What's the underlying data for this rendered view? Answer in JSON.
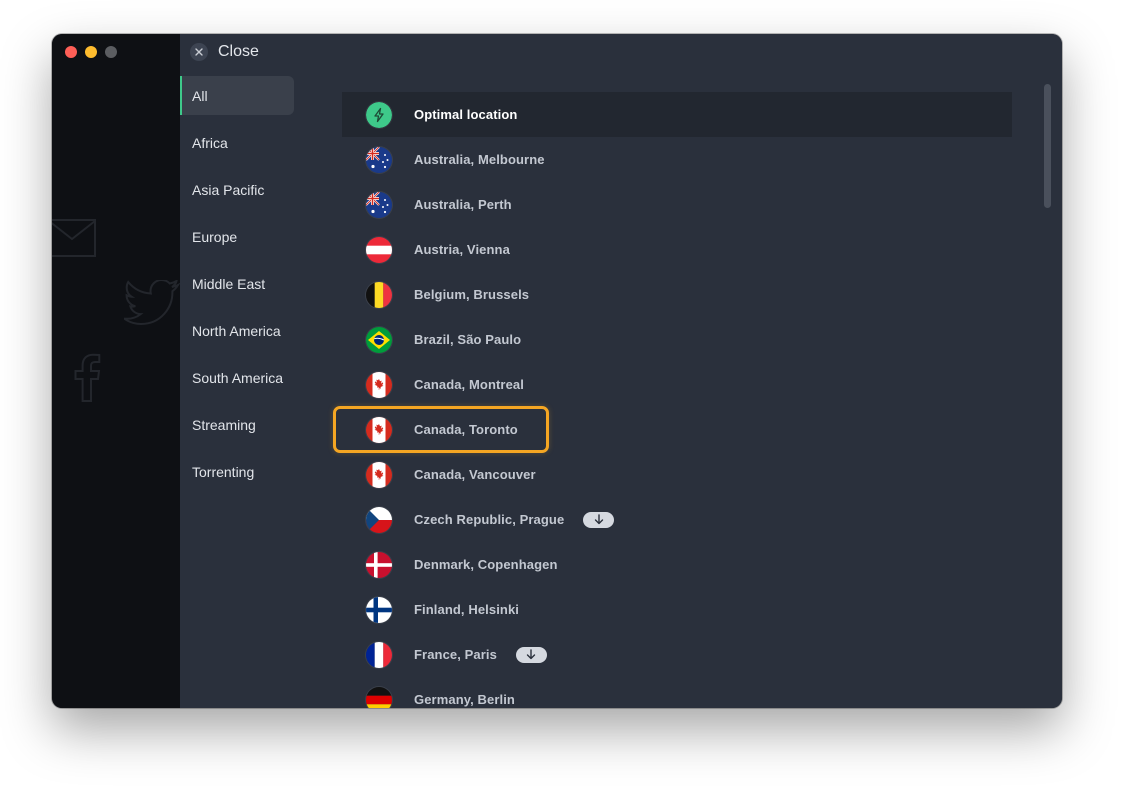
{
  "window": {
    "close_label": "Close"
  },
  "categories": [
    {
      "label": "All",
      "active": true
    },
    {
      "label": "Africa"
    },
    {
      "label": "Asia Pacific"
    },
    {
      "label": "Europe"
    },
    {
      "label": "Middle East"
    },
    {
      "label": "North America"
    },
    {
      "label": "South America"
    },
    {
      "label": "Streaming"
    },
    {
      "label": "Torrenting"
    }
  ],
  "locations": [
    {
      "label": "Optimal location",
      "icon": "bolt-icon"
    },
    {
      "label": "Australia, Melbourne",
      "flag": "australia-flag-icon"
    },
    {
      "label": "Australia, Perth",
      "flag": "australia-flag-icon"
    },
    {
      "label": "Austria, Vienna",
      "flag": "austria-flag-icon"
    },
    {
      "label": "Belgium, Brussels",
      "flag": "belgium-flag-icon"
    },
    {
      "label": "Brazil, São Paulo",
      "flag": "brazil-flag-icon"
    },
    {
      "label": "Canada, Montreal",
      "flag": "canada-flag-icon"
    },
    {
      "label": "Canada, Toronto",
      "flag": "canada-flag-icon",
      "highlighted": true
    },
    {
      "label": "Canada, Vancouver",
      "flag": "canada-flag-icon"
    },
    {
      "label": "Czech Republic, Prague",
      "flag": "czech-flag-icon",
      "badge": "download-arrow-icon"
    },
    {
      "label": "Denmark, Copenhagen",
      "flag": "denmark-flag-icon"
    },
    {
      "label": "Finland, Helsinki",
      "flag": "finland-flag-icon"
    },
    {
      "label": "France, Paris",
      "flag": "france-flag-icon",
      "badge": "download-arrow-icon"
    },
    {
      "label": "Germany, Berlin",
      "flag": "germany-flag-icon"
    }
  ],
  "colors": {
    "accent_green": "#3ec98a",
    "highlight_orange": "#f5a623",
    "panel_bg": "#2a303c",
    "sidebar_bg": "#0e1014"
  }
}
